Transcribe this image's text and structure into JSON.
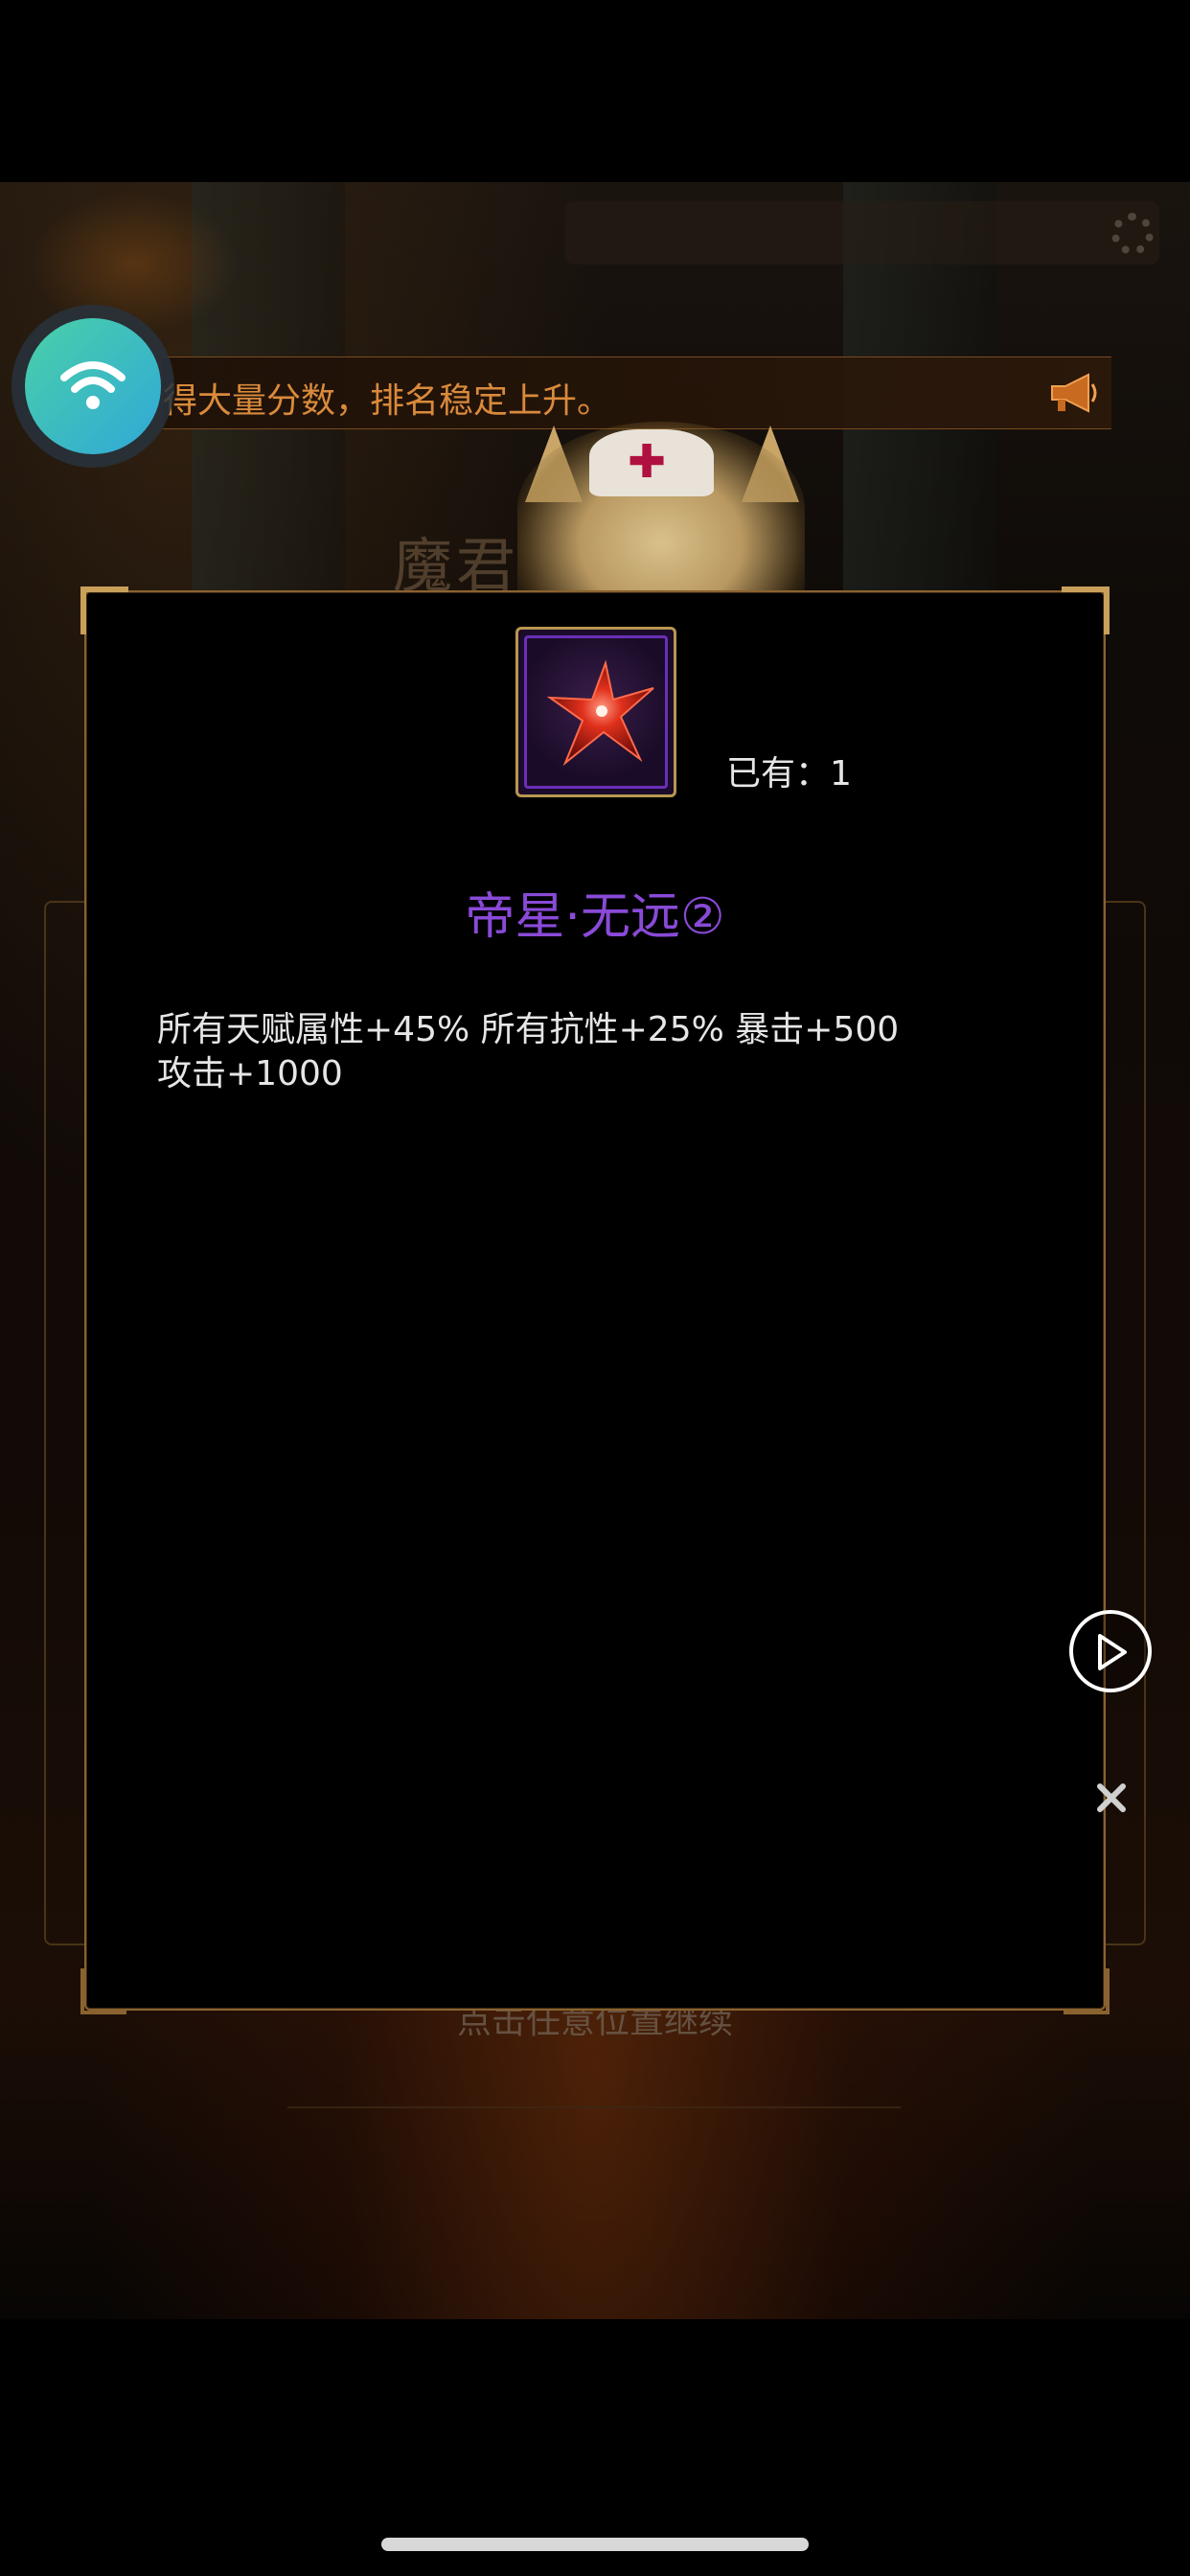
{
  "marquee": {
    "text": "得大量分数，排名稳定上升。"
  },
  "background": {
    "title_partial": "魔君",
    "continue_hint": "点击任意位置继续"
  },
  "modal": {
    "owned_label": "已有：",
    "owned_count": "1",
    "item_name": "帝星·无远②",
    "item_name_color": "#8a4ad8",
    "description_lines": [
      "所有天赋属性+45% 所有抗性+25% 暴击+500",
      "攻击+1000"
    ],
    "item_icon": "red-star-gem-icon"
  },
  "overlay": {
    "wifi_icon": "wifi-icon",
    "play_icon": "play-icon",
    "close_icon": "close-icon"
  }
}
